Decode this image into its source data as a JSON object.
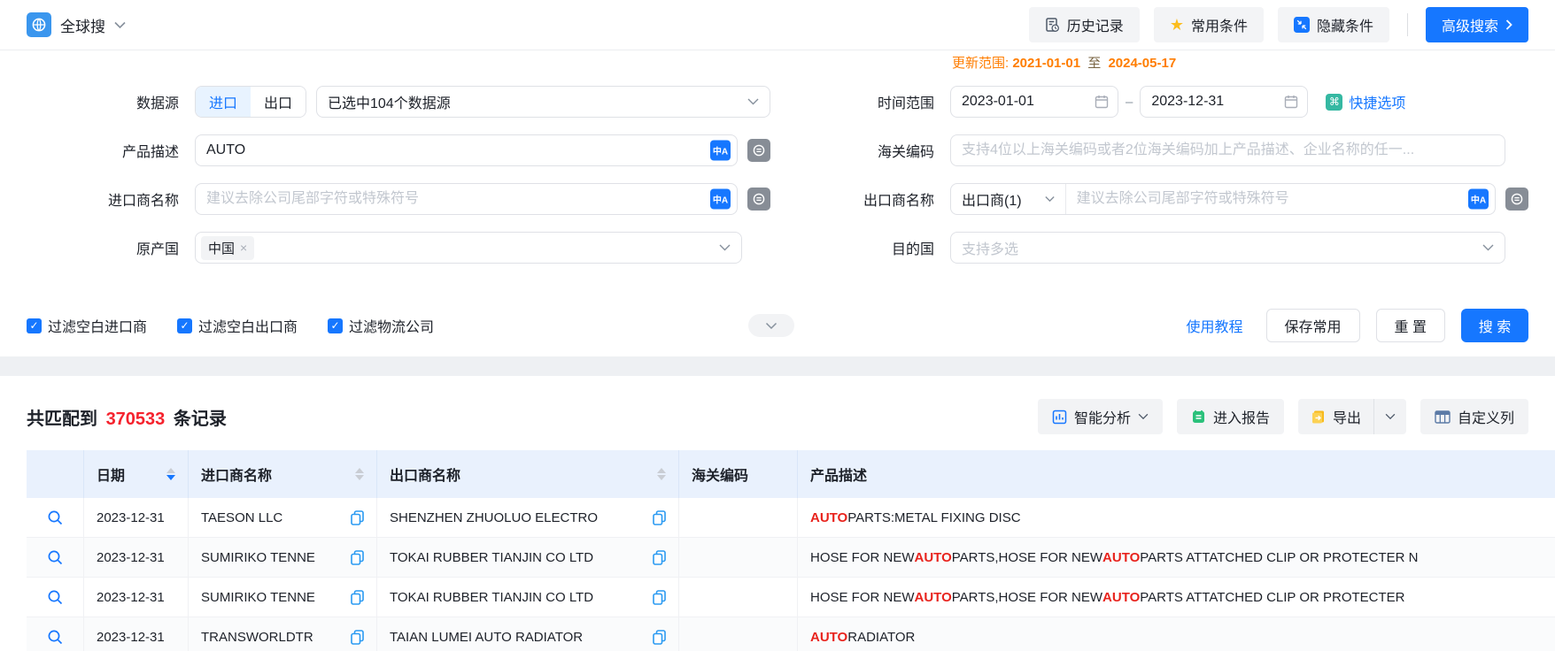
{
  "topbar": {
    "app_name": "全球搜",
    "history": "历史记录",
    "favorites": "常用条件",
    "hide_conditions": "隐藏条件",
    "advanced_search": "高级搜索"
  },
  "update_range": {
    "label": "更新范围:",
    "from": "2021-01-01",
    "to_word": "至",
    "to": "2024-05-17"
  },
  "form": {
    "datasource": {
      "label": "数据源",
      "import_tab": "进口",
      "export_tab": "出口",
      "selected": "已选中104个数据源"
    },
    "product": {
      "label": "产品描述",
      "value": "AUTO"
    },
    "importer": {
      "label": "进口商名称",
      "placeholder": "建议去除公司尾部字符或特殊符号"
    },
    "origin": {
      "label": "原产国",
      "tag": "中国",
      "remove": "×"
    },
    "time_range": {
      "label": "时间范围",
      "from": "2023-01-01",
      "separator": "–",
      "to": "2023-12-31",
      "quick_options": "快捷选项"
    },
    "hscode": {
      "label": "海关编码",
      "placeholder": "支持4位以上海关编码或者2位海关编码加上产品描述、企业名称的任一..."
    },
    "exporter": {
      "label": "出口商名称",
      "type_selector": "出口商(1)",
      "placeholder": "建议去除公司尾部字符或特殊符号"
    },
    "destination": {
      "label": "目的国",
      "placeholder": "支持多选"
    },
    "filters": [
      {
        "label": "过滤空白进口商",
        "checked": true
      },
      {
        "label": "过滤空白出口商",
        "checked": true
      },
      {
        "label": "过滤物流公司",
        "checked": true
      }
    ],
    "actions": {
      "tutorial": "使用教程",
      "save": "保存常用",
      "reset": "重 置",
      "search": "搜 索"
    }
  },
  "results": {
    "summary": {
      "prefix": "共匹配到",
      "count": "370533",
      "suffix": "条记录"
    },
    "toolbar": {
      "analysis": "智能分析",
      "report": "进入报告",
      "export": "导出",
      "custom_columns": "自定义列"
    },
    "table": {
      "headers": [
        "日期",
        "进口商名称",
        "出口商名称",
        "海关编码",
        "产品描述"
      ],
      "rows": [
        {
          "date": "2023-12-31",
          "importer": "TAESON LLC",
          "exporter": "SHENZHEN ZHUOLUO ELECTRO",
          "hscode": "",
          "product": [
            {
              "text": "AUTO",
              "highlight": true
            },
            {
              "text": " PARTS:METAL FIXING DISC",
              "highlight": false
            }
          ]
        },
        {
          "date": "2023-12-31",
          "importer": "SUMIRIKO TENNE",
          "exporter": "TOKAI RUBBER TIANJIN CO LTD",
          "hscode": "",
          "product": [
            {
              "text": "HOSE FOR NEW ",
              "highlight": false
            },
            {
              "text": "AUTO",
              "highlight": true
            },
            {
              "text": " PARTS,HOSE FOR NEW ",
              "highlight": false
            },
            {
              "text": "AUTO",
              "highlight": true
            },
            {
              "text": " PARTS ATTATCHED CLIP OR PROTECTER N",
              "highlight": false
            }
          ]
        },
        {
          "date": "2023-12-31",
          "importer": "SUMIRIKO TENNE",
          "exporter": "TOKAI RUBBER TIANJIN CO LTD",
          "hscode": "",
          "product": [
            {
              "text": "HOSE FOR NEW ",
              "highlight": false
            },
            {
              "text": "AUTO",
              "highlight": true
            },
            {
              "text": " PARTS,HOSE FOR NEW ",
              "highlight": false
            },
            {
              "text": "AUTO",
              "highlight": true
            },
            {
              "text": " PARTS ATTATCHED CLIP OR PROTECTER",
              "highlight": false
            }
          ]
        },
        {
          "date": "2023-12-31",
          "importer": "TRANSWORLDTR",
          "exporter": "TAIAN LUMEI AUTO RADIATOR",
          "hscode": "",
          "product": [
            {
              "text": "AUTO",
              "highlight": true
            },
            {
              "text": " RADIATOR",
              "highlight": false
            }
          ]
        }
      ]
    }
  },
  "icons": {
    "star": "★",
    "shortcut": "⌘",
    "translate": "中A",
    "check": "✓"
  },
  "colors": {
    "primary": "#1677ff",
    "highlight": "#e8231d",
    "count_red": "#f5222d",
    "update_orange": "#ff7d00"
  }
}
